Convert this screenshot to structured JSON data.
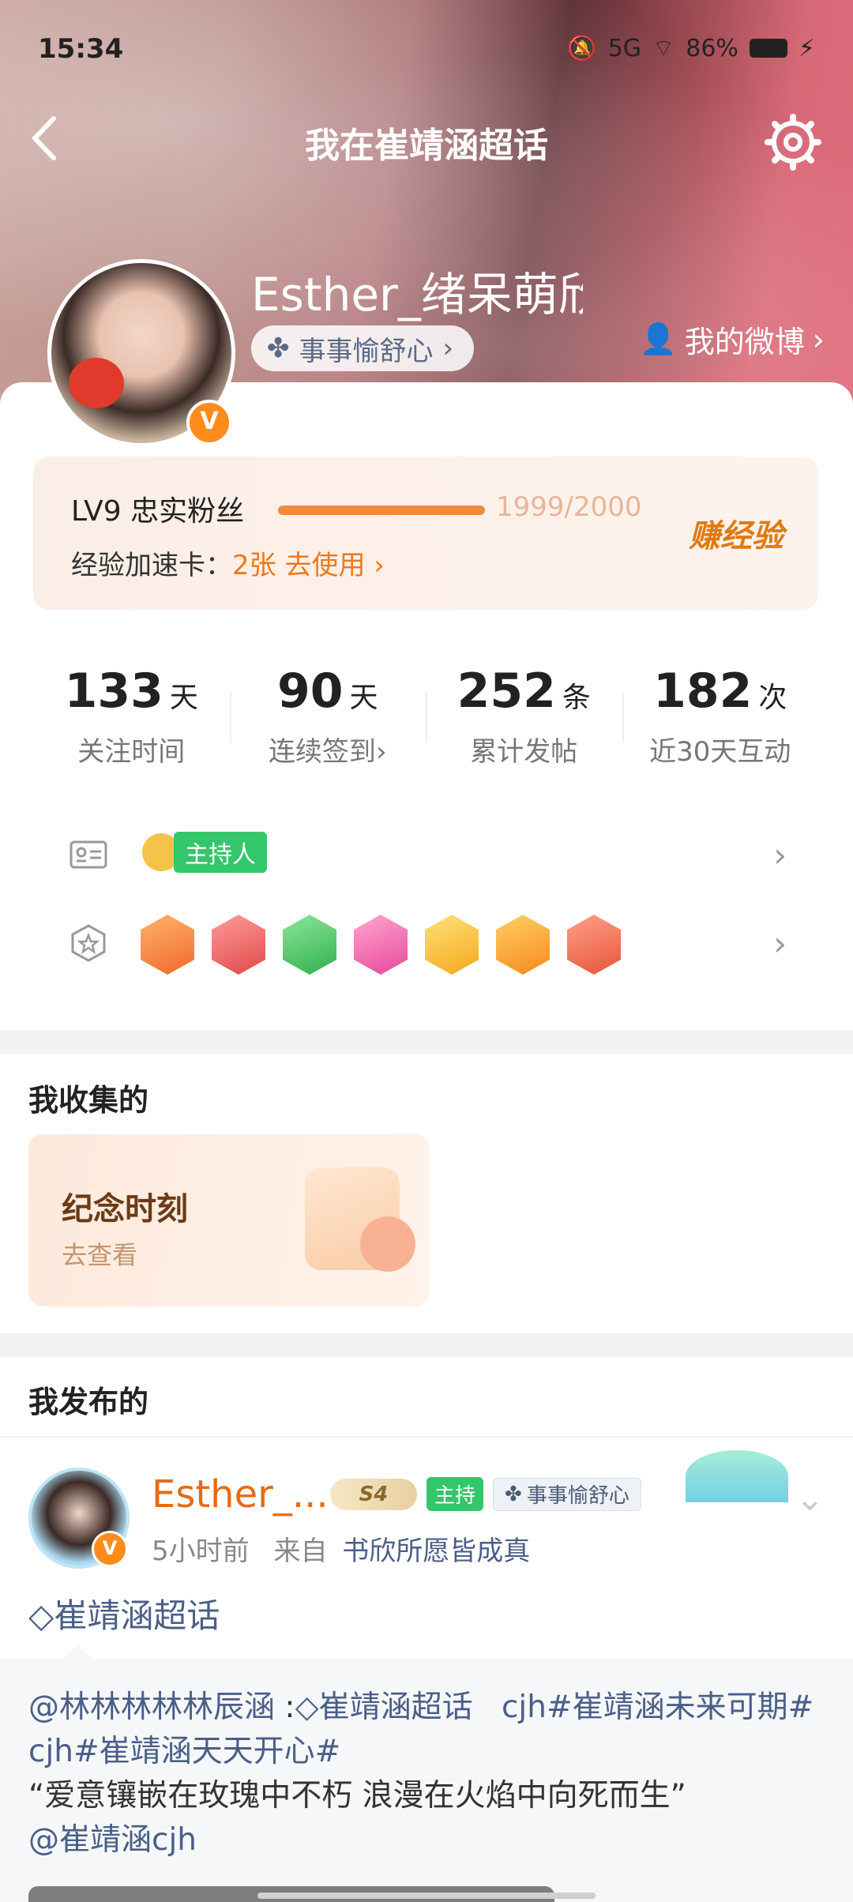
{
  "status_bar": {
    "time": "15:34",
    "battery": "86%",
    "network": "5G"
  },
  "nav": {
    "title": "我在崔靖涵超话"
  },
  "profile": {
    "username": "Esther_绪呆萌欣",
    "motto": "事事愉舒心",
    "my_weibo": "我的微博"
  },
  "level": {
    "title": "LV9 忠实粉丝",
    "progress_text": "1999/2000",
    "progress": 0.9995,
    "speed_label": "经验加速卡：",
    "speed_value": "2张 去使用",
    "earn": "赚经验"
  },
  "stats": [
    {
      "value": "133",
      "unit": "天",
      "label": "关注时间"
    },
    {
      "value": "90",
      "unit": "天",
      "label": "连续签到"
    },
    {
      "value": "252",
      "unit": "条",
      "label": "累计发帖"
    },
    {
      "value": "182",
      "unit": "次",
      "label": "近30天互动"
    }
  ],
  "badges": {
    "host_label": "主持人"
  },
  "sections": {
    "collected": "我收集的",
    "published": "我发布的"
  },
  "memory_card": {
    "title": "纪念时刻",
    "action": "去查看"
  },
  "post": {
    "author": "Esther_...",
    "level_tag": "S4",
    "host_tag": "主持",
    "motto_tag": "事事愉舒心",
    "time": "5小时前",
    "from": "来自",
    "source": "书欣所愿皆成真",
    "topic": "崔靖涵超话",
    "quote": {
      "mention": "@林林林林林辰涵",
      "topic": "崔靖涵超话",
      "text1": "cjh#崔靖涵未来可期#",
      "text2": "cjh#崔靖涵天天开心#",
      "text3": "“爱意镶嵌在玫瑰中不朽 浪漫在火焰中向死而生”",
      "at": "@崔靖涵cjh"
    }
  },
  "colors": {
    "accent": "#f07818",
    "link": "#4a5f88",
    "host_green": "#34c66b"
  }
}
